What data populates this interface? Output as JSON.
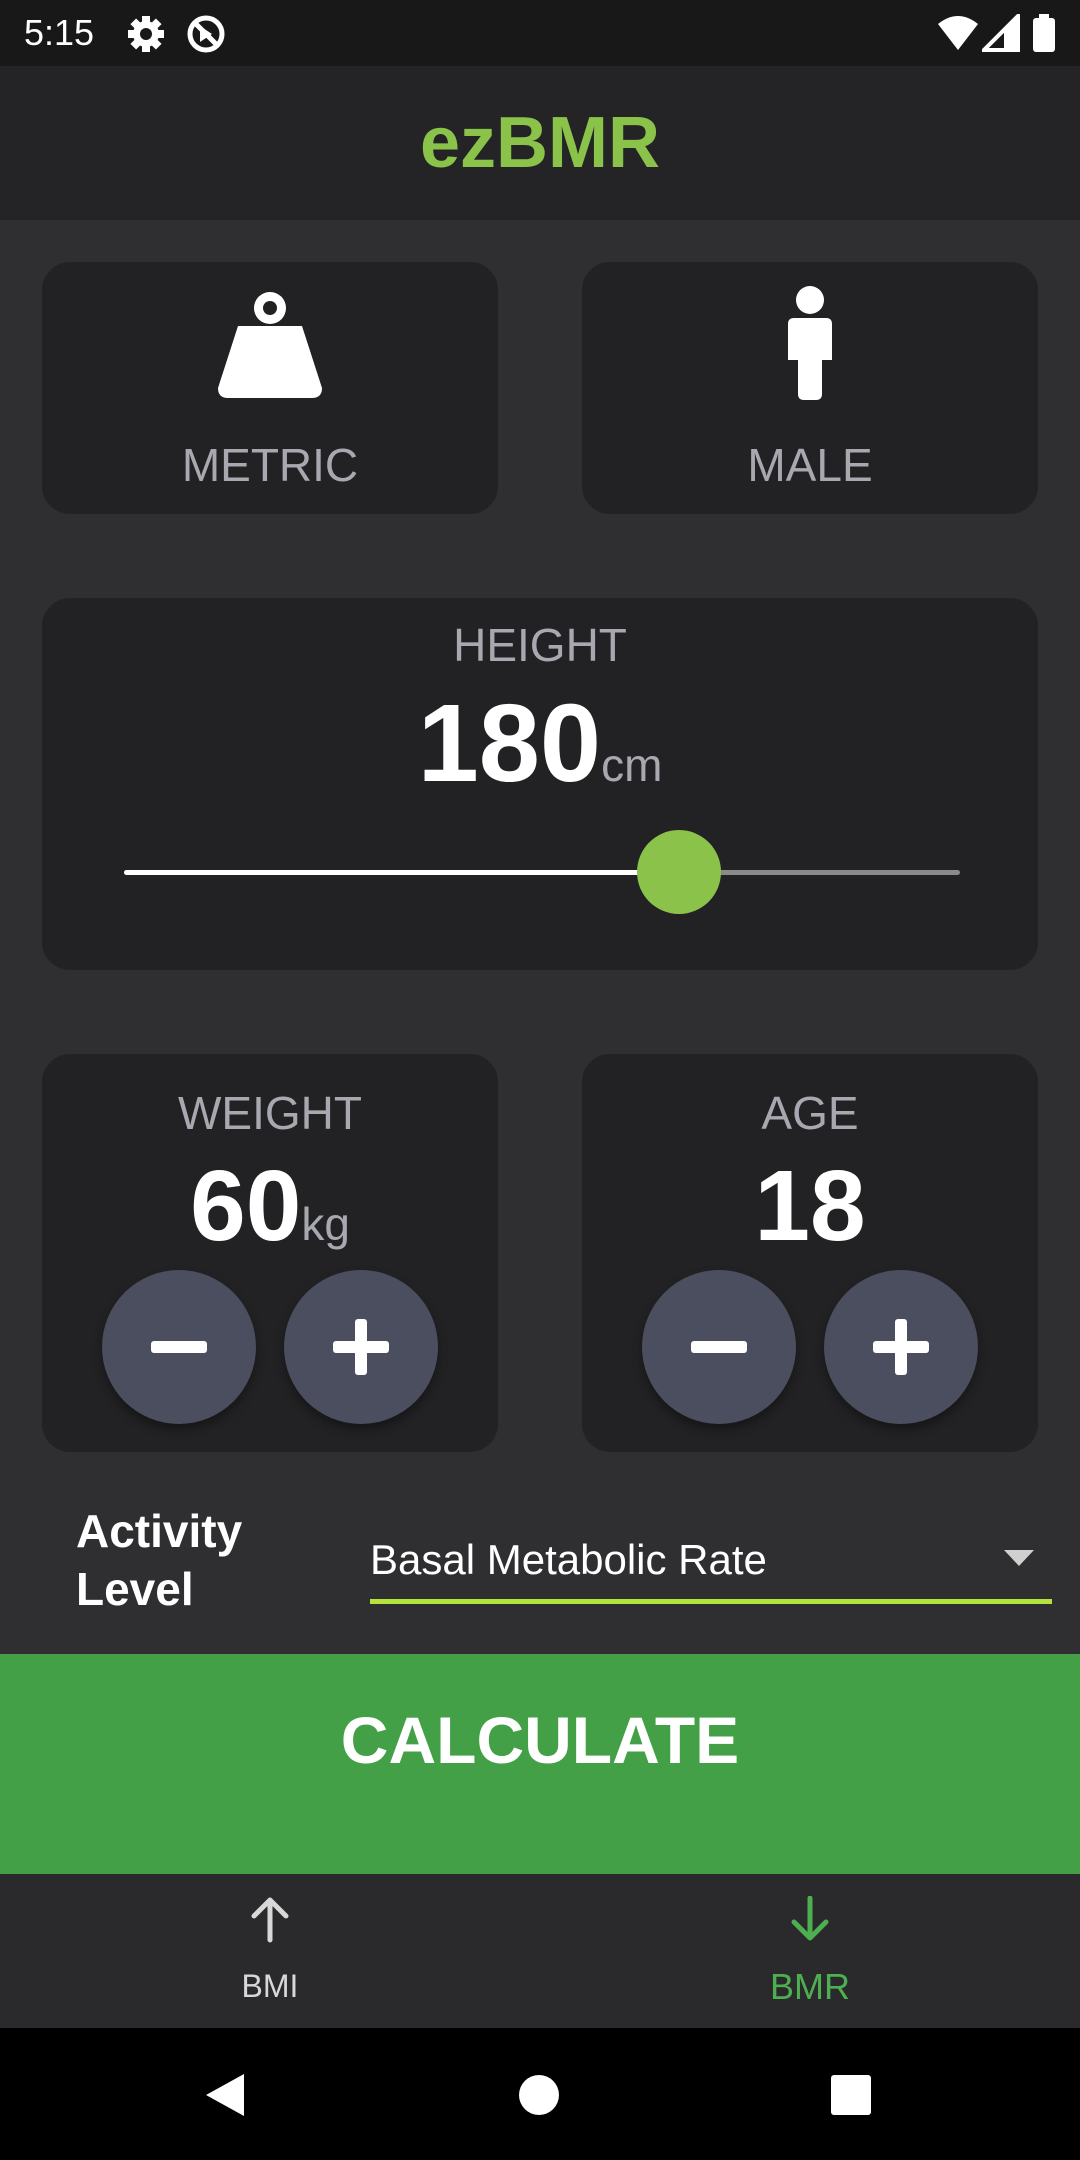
{
  "status_bar": {
    "time": "5:15",
    "icons": [
      "gear-icon",
      "sync-off-icon",
      "wifi-icon",
      "cell-signal-icon",
      "battery-icon"
    ]
  },
  "app": {
    "title": "ezBMR",
    "accent_color": "#8bc34a"
  },
  "unit_card": {
    "label": "METRIC",
    "icon": "weight-icon"
  },
  "gender_card": {
    "label": "MALE",
    "icon": "person-icon"
  },
  "height": {
    "label": "HEIGHT",
    "value": "180",
    "unit": "cm",
    "slider_fraction": 0.664
  },
  "weight": {
    "label": "WEIGHT",
    "value": "60",
    "unit": "kg"
  },
  "age": {
    "label": "AGE",
    "value": "18"
  },
  "activity": {
    "label_line1": "Activity",
    "label_line2": "Level",
    "selected": "Basal Metabolic Rate"
  },
  "calculate": {
    "label": "CALCULATE",
    "color": "#43a047"
  },
  "bottom_nav": {
    "items": [
      {
        "label": "BMI",
        "icon": "arrow-up-icon",
        "active": false
      },
      {
        "label": "BMR",
        "icon": "arrow-down-icon",
        "active": true
      }
    ]
  }
}
